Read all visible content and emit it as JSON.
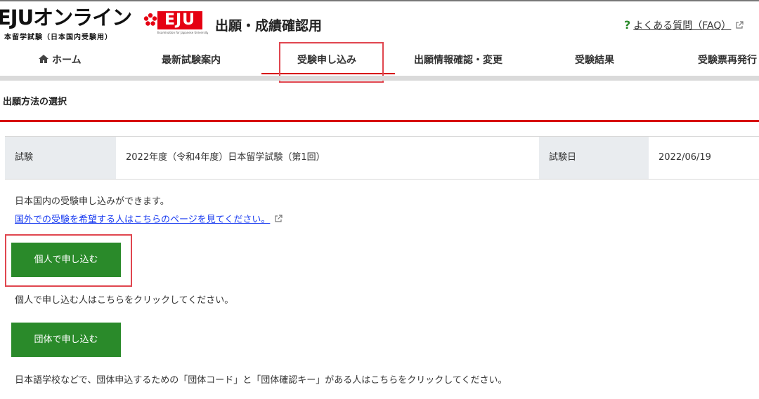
{
  "header": {
    "logo_main": "EJUオンライン",
    "logo_sub": "本留学試験（日本国内受験用）",
    "logo_badge": "EJU",
    "logo_badge_caption": "Examination for Japanese University Admission for International Students",
    "site_title": "出願・成績確認用",
    "faq_icon": "?",
    "faq_label": "よくある質問（FAQ）"
  },
  "nav": {
    "items": [
      {
        "label": "ホーム",
        "icon": "home-icon"
      },
      {
        "label": "最新試験案内"
      },
      {
        "label": "受験申し込み",
        "active": true
      },
      {
        "label": "出願情報確認・変更"
      },
      {
        "label": "受験結果"
      },
      {
        "label": "受験票再発行"
      }
    ]
  },
  "section": {
    "title": "出願方法の選択"
  },
  "exam_info": {
    "exam_label": "試験",
    "exam_value": "2022年度（令和4年度）日本留学試験（第1回）",
    "date_label": "試験日",
    "date_value": "2022/06/19"
  },
  "body": {
    "domestic_note": "日本国内の受験申し込みができます。",
    "overseas_link": "国外での受験を希望する人はこちらのページを見てください。",
    "individual_button": "個人で申し込む",
    "individual_note": "個人で申し込む人はこちらをクリックしてください。",
    "group_button": "団体で申し込む",
    "group_note": "日本語学校などで、団体申込するための「団体コード」と「団体確認キー」がある人はこちらをクリックしてください。"
  },
  "colors": {
    "accent_red": "#d7000f",
    "button_green": "#2a8a2a",
    "link_blue": "#1a3cf0",
    "highlight_box": "#e0464f"
  }
}
